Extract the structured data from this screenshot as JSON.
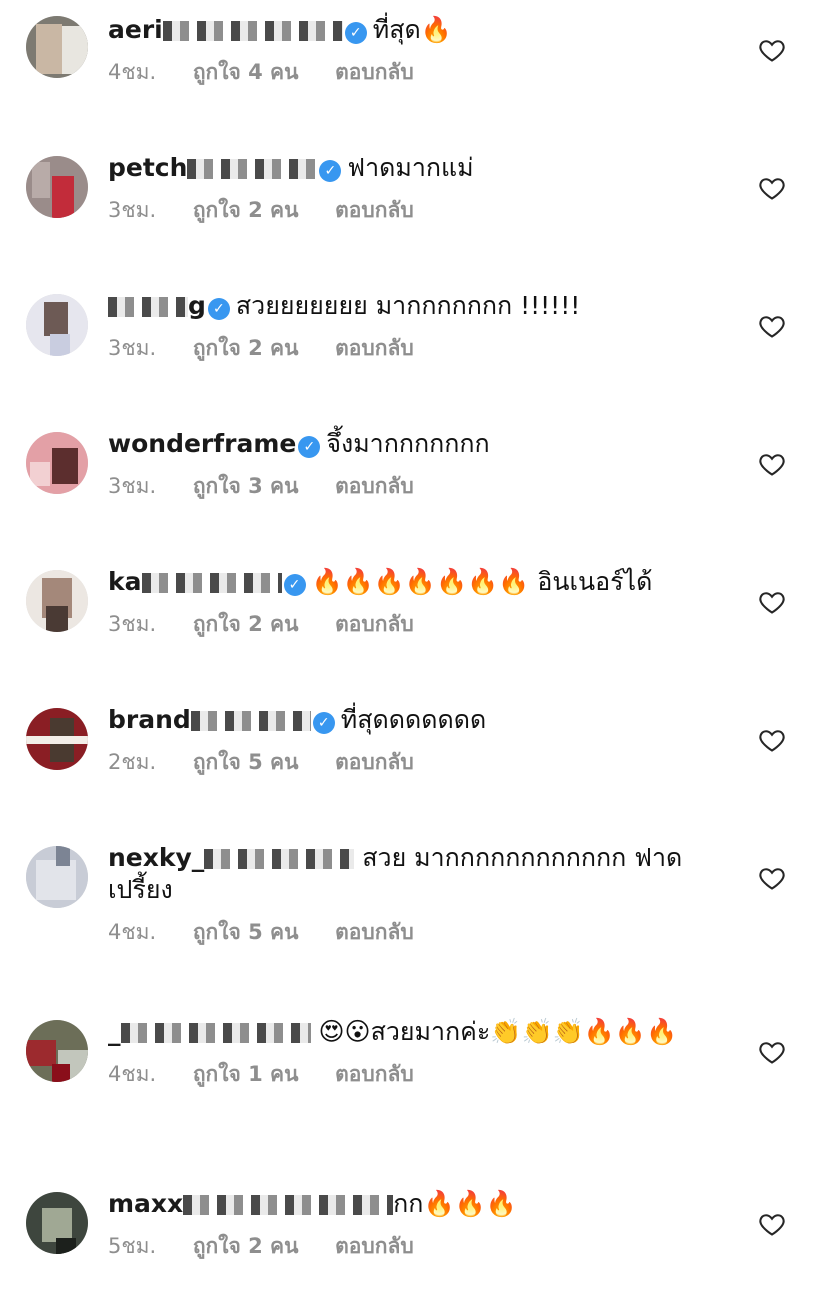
{
  "comments": [
    {
      "username": "aeri",
      "verified": true,
      "text": "ที่สุด🔥",
      "time": "4ชม.",
      "likes": "ถูกใจ 4 คน",
      "reply": "ตอบกลับ"
    },
    {
      "username": "petch",
      "verified": true,
      "text": "ฟาดมากแม่",
      "time": "3ชม.",
      "likes": "ถูกใจ 2 คน",
      "reply": "ตอบกลับ"
    },
    {
      "username": "g",
      "verified": true,
      "text": "สวยยยยยยย มากกกกกกก !!!!!!",
      "time": "3ชม.",
      "likes": "ถูกใจ 2 คน",
      "reply": "ตอบกลับ"
    },
    {
      "username": "wonderframe",
      "verified": true,
      "text": "จึ้งมากกกกกกก",
      "time": "3ชม.",
      "likes": "ถูกใจ 3 คน",
      "reply": "ตอบกลับ"
    },
    {
      "username": "ka",
      "verified": true,
      "text": "🔥🔥🔥🔥🔥🔥🔥 อินเนอร์ได้",
      "time": "3ชม.",
      "likes": "ถูกใจ 2 คน",
      "reply": "ตอบกลับ"
    },
    {
      "username": "brand",
      "verified": true,
      "text": "ที่สุดดดดดดด",
      "time": "2ชม.",
      "likes": "ถูกใจ 5 คน",
      "reply": "ตอบกลับ"
    },
    {
      "username": "nexky_",
      "verified": false,
      "text": "สวย มากกกกกกกกกกกก ฟาดเปรี้ยง",
      "time": "4ชม.",
      "likes": "ถูกใจ 5 คน",
      "reply": "ตอบกลับ"
    },
    {
      "username": "_",
      "verified": false,
      "text": "😍😮สวยมากค่ะ👏👏👏🔥🔥🔥",
      "time": "4ชม.",
      "likes": "ถูกใจ 1 คน",
      "reply": "ตอบกลับ"
    },
    {
      "username": "maxx",
      "verified": false,
      "text": "กก🔥🔥🔥",
      "time": "5ชม.",
      "likes": "ถูกใจ 2 คน",
      "reply": "ตอบกลับ"
    }
  ],
  "icons": {
    "heart": "heart-outline-icon",
    "verified": "verified-badge-icon"
  },
  "colors": {
    "verified": "#3897f0",
    "meta": "#8e8e8e"
  }
}
